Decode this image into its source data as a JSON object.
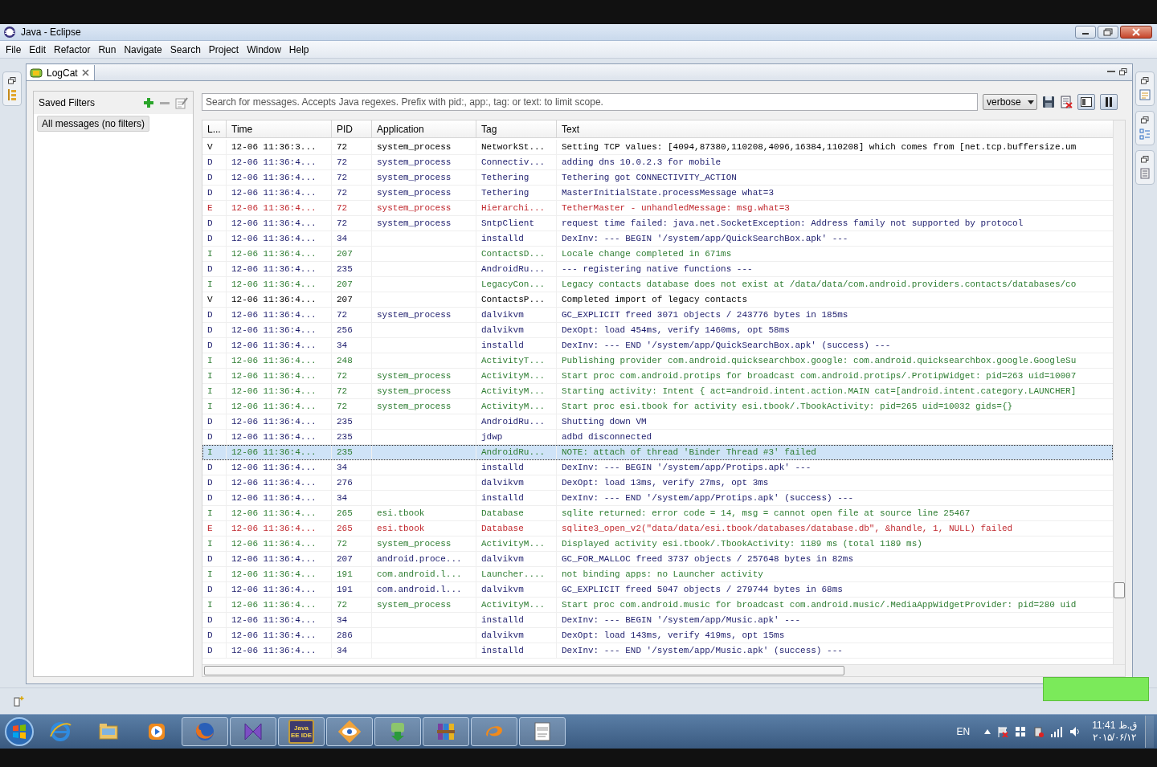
{
  "window": {
    "title": "Java - Eclipse"
  },
  "menu": [
    "File",
    "Edit",
    "Refactor",
    "Run",
    "Navigate",
    "Search",
    "Project",
    "Window",
    "Help"
  ],
  "view_tab": {
    "label": "LogCat",
    "selected": true
  },
  "saved_filters": {
    "title": "Saved Filters",
    "items": [
      {
        "label": "All messages (no filters)",
        "selected": true
      }
    ]
  },
  "search": {
    "placeholder": "Search for messages. Accepts Java regexes. Prefix with pid:, app:, tag: or text: to limit scope."
  },
  "log_level": {
    "value": "verbose"
  },
  "table": {
    "columns": [
      "L...",
      "Time",
      "PID",
      "Application",
      "Tag",
      "Text"
    ],
    "rows": [
      {
        "level": "V",
        "time": "12-06 11:36:3...",
        "pid": "72",
        "app": "system_process",
        "tag": "NetworkSt...",
        "text": "Setting TCP values: [4094,87380,110208,4096,16384,110208] which comes from [net.tcp.buffersize.um",
        "color": "#000000",
        "selected": false
      },
      {
        "level": "D",
        "time": "12-06 11:36:4...",
        "pid": "72",
        "app": "system_process",
        "tag": "Connectiv...",
        "text": "adding dns 10.0.2.3 for mobile",
        "color": "#1c1c6c",
        "selected": false
      },
      {
        "level": "D",
        "time": "12-06 11:36:4...",
        "pid": "72",
        "app": "system_process",
        "tag": "Tethering",
        "text": "Tethering got CONNECTIVITY_ACTION",
        "color": "#1c1c6c",
        "selected": false
      },
      {
        "level": "D",
        "time": "12-06 11:36:4...",
        "pid": "72",
        "app": "system_process",
        "tag": "Tethering",
        "text": "MasterInitialState.processMessage what=3",
        "color": "#1c1c6c",
        "selected": false
      },
      {
        "level": "E",
        "time": "12-06 11:36:4...",
        "pid": "72",
        "app": "system_process",
        "tag": "Hierarchi...",
        "text": "TetherMaster - unhandledMessage: msg.what=3",
        "color": "#c0282e",
        "selected": false
      },
      {
        "level": "D",
        "time": "12-06 11:36:4...",
        "pid": "72",
        "app": "system_process",
        "tag": "SntpClient",
        "text": "request time failed: java.net.SocketException: Address family not supported by protocol",
        "color": "#1c1c6c",
        "selected": false
      },
      {
        "level": "D",
        "time": "12-06 11:36:4...",
        "pid": "34",
        "tag": "installd",
        "text": "DexInv: --- BEGIN '/system/app/QuickSearchBox.apk' ---",
        "color": "#1c1c6c",
        "selected": false
      },
      {
        "level": "I",
        "time": "12-06 11:36:4...",
        "pid": "207",
        "tag": "ContactsD...",
        "text": "Locale change completed in 671ms",
        "color": "#2e7d32",
        "selected": false
      },
      {
        "level": "D",
        "time": "12-06 11:36:4...",
        "pid": "235",
        "tag": "AndroidRu...",
        "text": "--- registering native functions ---",
        "color": "#1c1c6c",
        "selected": false
      },
      {
        "level": "I",
        "time": "12-06 11:36:4...",
        "pid": "207",
        "tag": "LegacyCon...",
        "text": "Legacy contacts database does not exist at /data/data/com.android.providers.contacts/databases/co",
        "color": "#2e7d32",
        "selected": false
      },
      {
        "level": "V",
        "time": "12-06 11:36:4...",
        "pid": "207",
        "tag": "ContactsP...",
        "text": "Completed import of legacy contacts",
        "color": "#000000",
        "selected": false
      },
      {
        "level": "D",
        "time": "12-06 11:36:4...",
        "pid": "72",
        "app": "system_process",
        "tag": "dalvikvm",
        "text": "GC_EXPLICIT freed 3071 objects / 243776 bytes in 185ms",
        "color": "#1c1c6c",
        "selected": false
      },
      {
        "level": "D",
        "time": "12-06 11:36:4...",
        "pid": "256",
        "tag": "dalvikvm",
        "text": "DexOpt: load 454ms, verify 1460ms, opt 58ms",
        "color": "#1c1c6c",
        "selected": false
      },
      {
        "level": "D",
        "time": "12-06 11:36:4...",
        "pid": "34",
        "tag": "installd",
        "text": "DexInv: --- END '/system/app/QuickSearchBox.apk' (success) ---",
        "color": "#1c1c6c",
        "selected": false
      },
      {
        "level": "I",
        "time": "12-06 11:36:4...",
        "pid": "248",
        "tag": "ActivityT...",
        "text": "Publishing provider com.android.quicksearchbox.google: com.android.quicksearchbox.google.GoogleSu",
        "color": "#2e7d32",
        "selected": false
      },
      {
        "level": "I",
        "time": "12-06 11:36:4...",
        "pid": "72",
        "app": "system_process",
        "tag": "ActivityM...",
        "text": "Start proc com.android.protips for broadcast com.android.protips/.ProtipWidget: pid=263 uid=10007",
        "color": "#2e7d32",
        "selected": false
      },
      {
        "level": "I",
        "time": "12-06 11:36:4...",
        "pid": "72",
        "app": "system_process",
        "tag": "ActivityM...",
        "text": "Starting activity: Intent { act=android.intent.action.MAIN cat=[android.intent.category.LAUNCHER]",
        "color": "#2e7d32",
        "selected": false
      },
      {
        "level": "I",
        "time": "12-06 11:36:4...",
        "pid": "72",
        "app": "system_process",
        "tag": "ActivityM...",
        "text": "Start proc esi.tbook for activity esi.tbook/.TbookActivity: pid=265 uid=10032 gids={}",
        "color": "#2e7d32",
        "selected": false
      },
      {
        "level": "D",
        "time": "12-06 11:36:4...",
        "pid": "235",
        "tag": "AndroidRu...",
        "text": "Shutting down VM",
        "color": "#1c1c6c",
        "selected": false
      },
      {
        "level": "D",
        "time": "12-06 11:36:4...",
        "pid": "235",
        "tag": "jdwp",
        "text": "adbd disconnected",
        "color": "#1c1c6c",
        "selected": false
      },
      {
        "level": "I",
        "time": "12-06 11:36:4...",
        "pid": "235",
        "tag": "AndroidRu...",
        "text": "NOTE: attach of thread 'Binder Thread #3' failed",
        "color": "#2e7d32",
        "selected": true
      },
      {
        "level": "D",
        "time": "12-06 11:36:4...",
        "pid": "34",
        "tag": "installd",
        "text": "DexInv: --- BEGIN '/system/app/Protips.apk' ---",
        "color": "#1c1c6c",
        "selected": false
      },
      {
        "level": "D",
        "time": "12-06 11:36:4...",
        "pid": "276",
        "tag": "dalvikvm",
        "text": "DexOpt: load 13ms, verify 27ms, opt 3ms",
        "color": "#1c1c6c",
        "selected": false
      },
      {
        "level": "D",
        "time": "12-06 11:36:4...",
        "pid": "34",
        "tag": "installd",
        "text": "DexInv: --- END '/system/app/Protips.apk' (success) ---",
        "color": "#1c1c6c",
        "selected": false
      },
      {
        "level": "I",
        "time": "12-06 11:36:4...",
        "pid": "265",
        "app": "esi.tbook",
        "tag": "Database",
        "text": "sqlite returned: error code = 14, msg = cannot open file at source line 25467",
        "color": "#2e7d32",
        "selected": false
      },
      {
        "level": "E",
        "time": "12-06 11:36:4...",
        "pid": "265",
        "app": "esi.tbook",
        "tag": "Database",
        "text": "sqlite3_open_v2(\"data/data/esi.tbook/databases/database.db\", &handle, 1, NULL) failed",
        "color": "#c0282e",
        "selected": false
      },
      {
        "level": "I",
        "time": "12-06 11:36:4...",
        "pid": "72",
        "app": "system_process",
        "tag": "ActivityM...",
        "text": "Displayed activity esi.tbook/.TbookActivity: 1189 ms (total 1189 ms)",
        "color": "#2e7d32",
        "selected": false
      },
      {
        "level": "D",
        "time": "12-06 11:36:4...",
        "pid": "207",
        "app": "android.proce...",
        "tag": "dalvikvm",
        "text": "GC_FOR_MALLOC freed 3737 objects / 257648 bytes in 82ms",
        "color": "#1c1c6c",
        "selected": false
      },
      {
        "level": "I",
        "time": "12-06 11:36:4...",
        "pid": "191",
        "app": "com.android.l...",
        "tag": "Launcher....",
        "text": "not binding apps: no Launcher activity",
        "color": "#2e7d32",
        "selected": false
      },
      {
        "level": "D",
        "time": "12-06 11:36:4...",
        "pid": "191",
        "app": "com.android.l...",
        "tag": "dalvikvm",
        "text": "GC_EXPLICIT freed 5047 objects / 279744 bytes in 68ms",
        "color": "#1c1c6c",
        "selected": false
      },
      {
        "level": "I",
        "time": "12-06 11:36:4...",
        "pid": "72",
        "app": "system_process",
        "tag": "ActivityM...",
        "text": "Start proc com.android.music for broadcast com.android.music/.MediaAppWidgetProvider: pid=280 uid",
        "color": "#2e7d32",
        "selected": false
      },
      {
        "level": "D",
        "time": "12-06 11:36:4...",
        "pid": "34",
        "tag": "installd",
        "text": "DexInv: --- BEGIN '/system/app/Music.apk' ---",
        "color": "#1c1c6c",
        "selected": false
      },
      {
        "level": "D",
        "time": "12-06 11:36:4...",
        "pid": "286",
        "tag": "dalvikvm",
        "text": "DexOpt: load 143ms, verify 419ms, opt 15ms",
        "color": "#1c1c6c",
        "selected": false
      },
      {
        "level": "D",
        "time": "12-06 11:36:4...",
        "pid": "34",
        "tag": "installd",
        "text": "DexInv: --- END '/system/app/Music.apk' (success) ---",
        "color": "#1c1c6c",
        "selected": false
      }
    ]
  },
  "taskbar": {
    "items": [
      {
        "kind": "browser",
        "running": false
      },
      {
        "kind": "folder",
        "running": false
      },
      {
        "kind": "player",
        "running": false
      },
      {
        "kind": "fox",
        "running": true
      },
      {
        "kind": "ribbon",
        "running": true
      },
      {
        "kind": "gear",
        "running": true,
        "label": "Java EE IDE"
      },
      {
        "kind": "eye",
        "running": true
      },
      {
        "kind": "download",
        "running": true
      },
      {
        "kind": "books",
        "running": true
      },
      {
        "kind": "swirl",
        "running": true
      },
      {
        "kind": "document",
        "running": true
      }
    ],
    "language": "EN",
    "time": "11:41 ق.ظ",
    "date": "۲۰۱۵/۰۶/۱۲"
  }
}
